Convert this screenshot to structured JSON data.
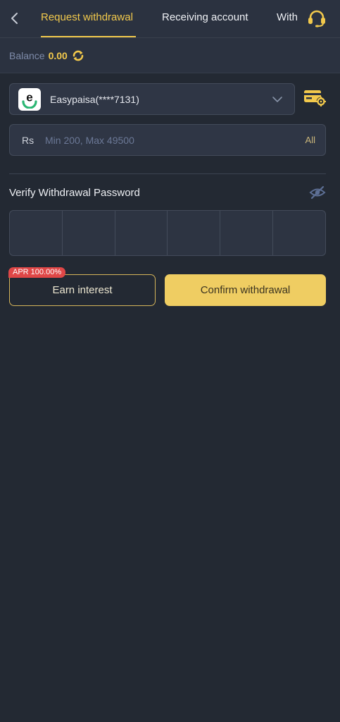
{
  "header": {
    "tabs": [
      {
        "label": "Request withdrawal",
        "active": true
      },
      {
        "label": "Receiving account",
        "active": false
      },
      {
        "label": "With",
        "active": false
      }
    ]
  },
  "balance": {
    "label": "Balance",
    "value": "0.00"
  },
  "account": {
    "name": "Easypaisa(****7131)",
    "logo_letter": "e"
  },
  "amount": {
    "currency": "Rs",
    "placeholder": "Min 200, Max 49500",
    "all_label": "All"
  },
  "verify": {
    "label": "Verify Withdrawal Password",
    "digits": 6
  },
  "buttons": {
    "apr_badge": "APR 100.00%",
    "earn": "Earn interest",
    "confirm": "Confirm withdrawal"
  },
  "colors": {
    "accent": "#f2c94c",
    "background": "#232933",
    "badge": "#e04747"
  }
}
